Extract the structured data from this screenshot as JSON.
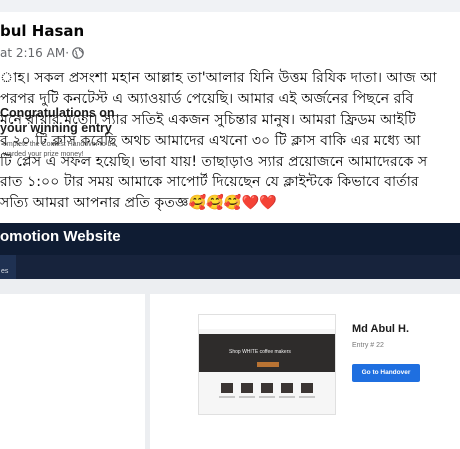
{
  "post": {
    "author_name": "bul Hasan",
    "timestamp": "at 2:16 AM",
    "separator": " · ",
    "privacy_icon": "globe-icon",
    "lines": [
      "াহ। সকল প্রসংশা মহান আল্লাহ তা'আলার যিনি উত্তম রিযিক দাতা। আজ আ",
      " পরপর দুটি কনটেস্ট এ অ্যাওয়ার্ড পেয়েছি। আমার এই অর্জনের পিছনে রবি",
      "মনে রাখার মতো। স্যার সতিই একজন সুচিন্তার মানুষ। আমরা ফ্রিডম আইটি",
      "র ২০ টি ক্লাস করেছি অথচ আমাদের এখনো ৩০ টি ক্লাস বাকি এর মধ্যে আ",
      "টি প্লেস এ সফল হয়েছি। ভাবা যায়! তাছাড়াও স্যার প্রয়োজনে আমাদেরকে স",
      "রাত ১:০০ টার সময় আমাকে সাপোর্ট দিয়েছেন যে ক্লাইন্টকে কিভাবে বার্তার",
      " সত্যি আমরা আপনার প্রতি কৃতজ্ঞ🥰🥰🥰❤️❤️"
    ]
  },
  "screenshot": {
    "site_title": "omotion Website",
    "nav_tab": "es",
    "card_heading_line1": "Congratulations on",
    "card_heading_line2": "your winning entry",
    "card_sub_line1": "omplete the Contest Handover to be",
    "card_sub_line2": "warded your prize money!",
    "thumbnail_hero_text": "Shop WHITE coffee makers",
    "winner_name": "Md Abul H.",
    "entry_number": "Entry # 22",
    "handover_button": "Go to Handover"
  },
  "colors": {
    "screenshot_header": "#0f1c33",
    "handover_button": "#1f6fe0",
    "meta_text": "#65676b"
  }
}
